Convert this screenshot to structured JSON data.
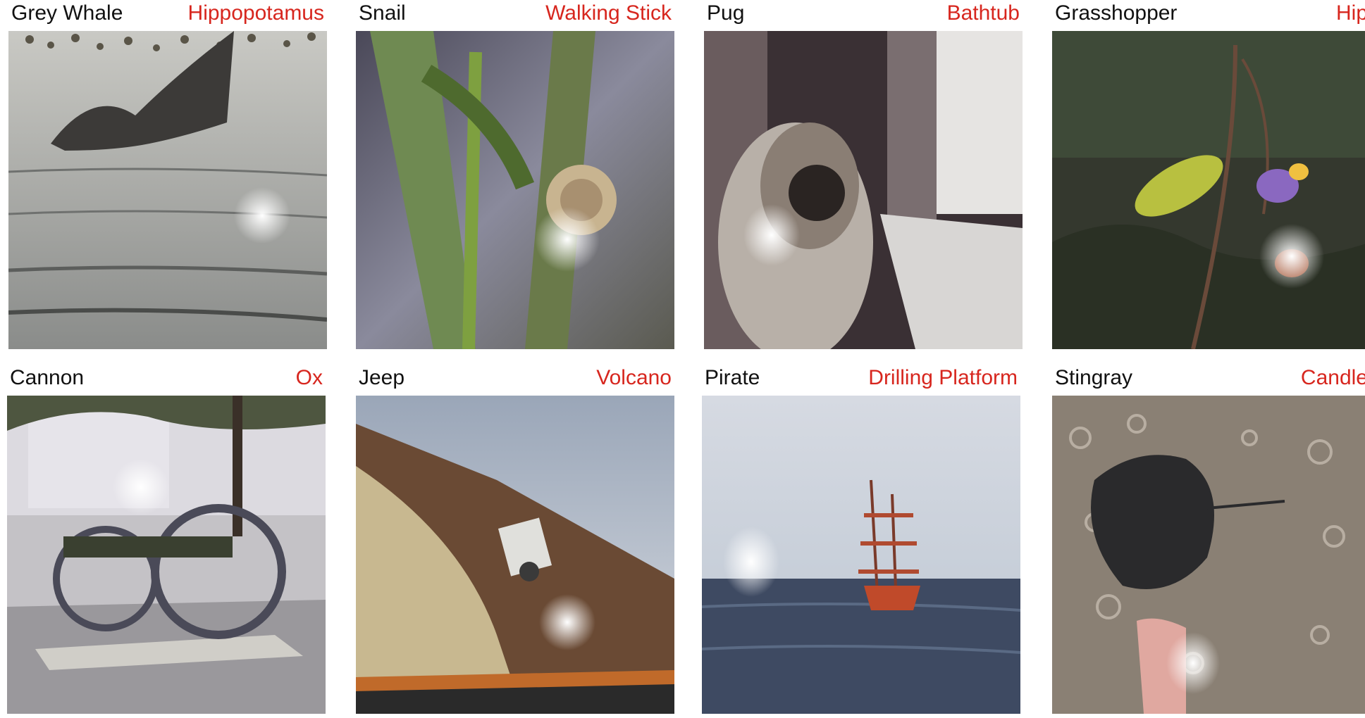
{
  "panels": [
    {
      "true_label": "Grey Whale",
      "predicted_label": "Hippopotamus",
      "subject": "grey-whale-tail-photo"
    },
    {
      "true_label": "Snail",
      "predicted_label": "Walking Stick",
      "subject": "snail-on-stem-photo"
    },
    {
      "true_label": "Pug",
      "predicted_label": "Bathtub",
      "subject": "pug-by-window-photo"
    },
    {
      "true_label": "Grasshopper",
      "predicted_label": "Hip",
      "subject": "grasshopper-on-flower-photo"
    },
    {
      "true_label": "Cannon",
      "predicted_label": "Ox",
      "subject": "cannon-on-wheels-photo"
    },
    {
      "true_label": "Jeep",
      "predicted_label": "Volcano",
      "subject": "jeep-on-dirt-road-photo"
    },
    {
      "true_label": "Pirate",
      "predicted_label": "Drilling Platform",
      "subject": "pirate-ship-at-sea-photo"
    },
    {
      "true_label": "Stingray",
      "predicted_label": "Candle",
      "subject": "stingray-underwater-photo"
    }
  ],
  "colors": {
    "true_label": "#111111",
    "predicted_label": "#d7261e"
  }
}
